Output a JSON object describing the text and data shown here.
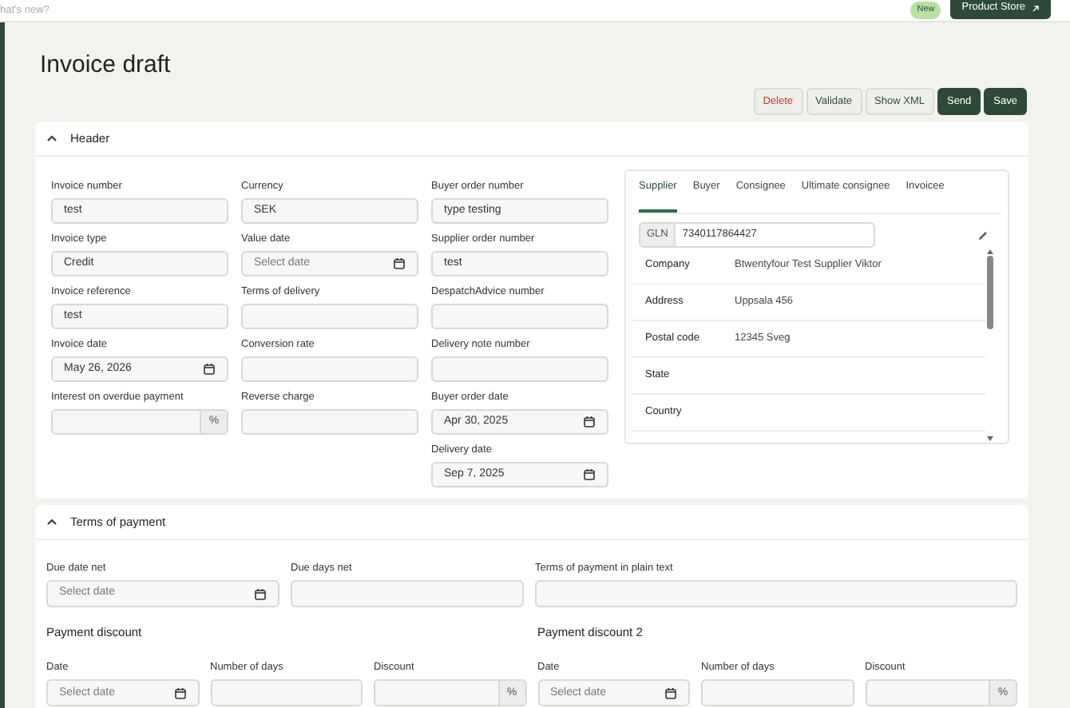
{
  "topbar": {
    "whats_new": "hat's new?",
    "badge": "New",
    "store_button": "Product Store"
  },
  "title": "Invoice draft",
  "actions": [
    {
      "label": "Delete",
      "kind": "danger"
    },
    {
      "label": "Validate",
      "kind": "secondary"
    },
    {
      "label": "Show XML",
      "kind": "secondary"
    },
    {
      "label": "Send",
      "kind": "primary"
    },
    {
      "label": "Save",
      "kind": "primary"
    }
  ],
  "header": {
    "title": "Header",
    "expanded": true,
    "columns": [
      [
        {
          "label": "Invoice number",
          "kind": "text",
          "value": "test"
        },
        {
          "label": "Invoice type",
          "kind": "text",
          "value": "Credit"
        },
        {
          "label": "Invoice reference",
          "kind": "text",
          "value": "test"
        },
        {
          "label": "Invoice date",
          "kind": "date",
          "value": "May 26, 2026"
        },
        {
          "label": "Interest on overdue payment",
          "kind": "percent",
          "unit": "%"
        }
      ],
      [
        {
          "label": "Currency",
          "kind": "text",
          "value": "SEK"
        },
        {
          "label": "Value date",
          "kind": "date",
          "placeholder": "Select date"
        },
        {
          "label": "Terms of delivery",
          "kind": "text"
        },
        {
          "label": "Conversion rate",
          "kind": "text"
        },
        {
          "label": "Reverse charge",
          "kind": "text"
        }
      ],
      [
        {
          "label": "Buyer order number",
          "kind": "text",
          "value": "type testing"
        },
        {
          "label": "Supplier order number",
          "kind": "text",
          "value": "test"
        },
        {
          "label": "DespatchAdvice number",
          "kind": "text"
        },
        {
          "label": "Delivery note number",
          "kind": "text"
        },
        {
          "label": "Buyer order date",
          "kind": "date",
          "value": "Apr 30, 2025"
        },
        {
          "label": "Delivery date",
          "kind": "date",
          "value": "Sep 7, 2025"
        }
      ]
    ],
    "party": {
      "tabs": [
        {
          "label": "Supplier",
          "selected": true
        },
        {
          "label": "Buyer",
          "selected": false
        },
        {
          "label": "Consignee",
          "selected": false
        },
        {
          "label": "Ultimate consignee",
          "selected": false
        },
        {
          "label": "Invoicee",
          "selected": false
        }
      ],
      "gln_label": "GLN",
      "gln_value": "7340117864427",
      "rows": [
        {
          "label": "Company",
          "value": "Btwentyfour Test Supplier Viktor"
        },
        {
          "label": "Address",
          "value": "Uppsala 456"
        },
        {
          "label": "Postal code",
          "value": "12345 Sveg"
        },
        {
          "label": "State"
        },
        {
          "label": "Country"
        }
      ]
    }
  },
  "terms": {
    "title": "Terms of payment",
    "expanded": true,
    "fields": [
      {
        "label": "Due date net",
        "kind": "date",
        "placeholder": "Select date"
      },
      {
        "label": "Due days net",
        "kind": "text"
      },
      {
        "label": "Terms of payment in plain text",
        "kind": "text"
      }
    ],
    "discounts": [
      {
        "title": "Payment discount",
        "fields": [
          {
            "label": "Date",
            "kind": "date",
            "placeholder": "Select date"
          },
          {
            "label": "Number of days",
            "kind": "text"
          },
          {
            "label": "Discount",
            "kind": "percent",
            "unit": "%"
          }
        ]
      },
      {
        "title": "Payment discount 2",
        "fields": [
          {
            "label": "Date",
            "kind": "date",
            "placeholder": "Select date"
          },
          {
            "label": "Number of days",
            "kind": "text"
          },
          {
            "label": "Discount",
            "kind": "percent",
            "unit": "%"
          }
        ]
      }
    ]
  }
}
